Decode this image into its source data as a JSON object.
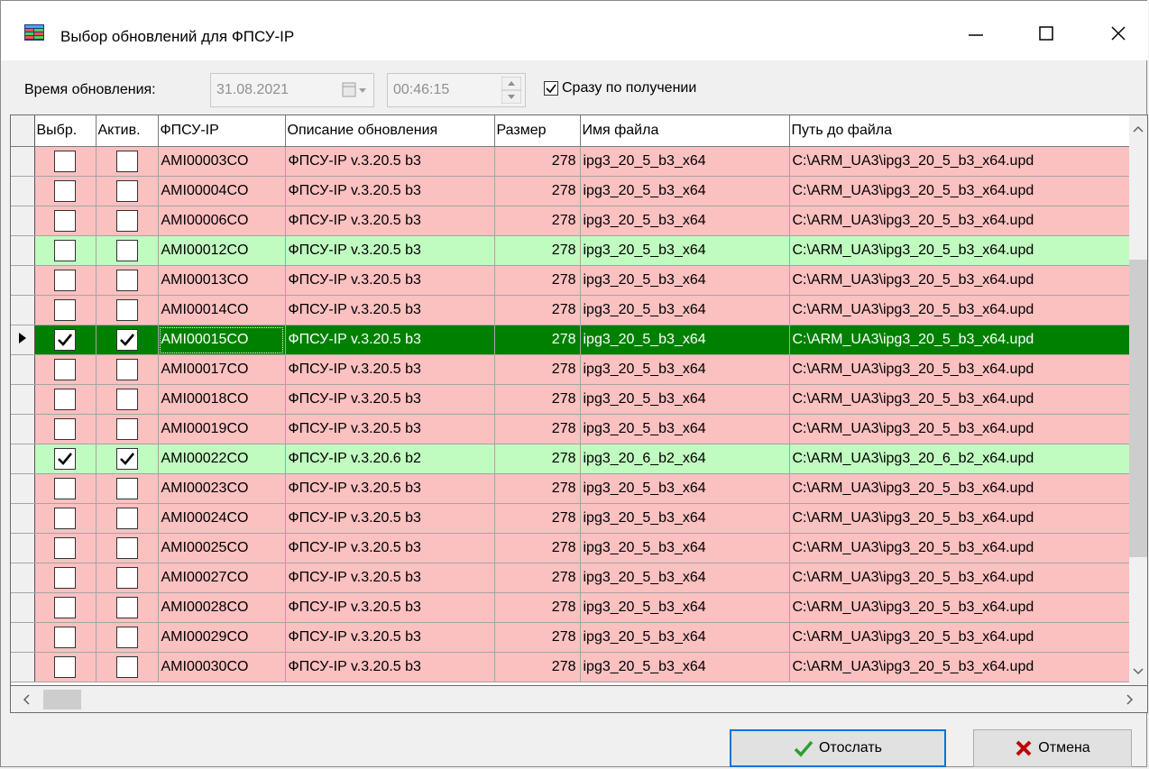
{
  "window": {
    "title": "Выбор обновлений для ФПСУ-IP"
  },
  "toolbar": {
    "time_label": "Время обновления:",
    "date_value": "31.08.2021",
    "time_value": "00:46:15",
    "immediate_label": "Сразу по получении",
    "immediate_checked": true
  },
  "table": {
    "headers": [
      "Выбр.",
      "Актив.",
      "ФПСУ-IP",
      "Описание обновления",
      "Размер",
      "Имя файла",
      "Путь до файла"
    ],
    "rows": [
      {
        "sel": false,
        "act": false,
        "id": "AMI00003CO",
        "desc": "ФПСУ-IP v.3.20.5 b3",
        "size": "278",
        "file": "ipg3_20_5_b3_x64",
        "path": "C:\\ARM_UA3\\ipg3_20_5_b3_x64.upd",
        "status": "red"
      },
      {
        "sel": false,
        "act": false,
        "id": "AMI00004CO",
        "desc": "ФПСУ-IP v.3.20.5 b3",
        "size": "278",
        "file": "ipg3_20_5_b3_x64",
        "path": "C:\\ARM_UA3\\ipg3_20_5_b3_x64.upd",
        "status": "red"
      },
      {
        "sel": false,
        "act": false,
        "id": "AMI00006CO",
        "desc": "ФПСУ-IP v.3.20.5 b3",
        "size": "278",
        "file": "ipg3_20_5_b3_x64",
        "path": "C:\\ARM_UA3\\ipg3_20_5_b3_x64.upd",
        "status": "red"
      },
      {
        "sel": false,
        "act": false,
        "id": "AMI00012CO",
        "desc": "ФПСУ-IP v.3.20.5 b3",
        "size": "278",
        "file": "ipg3_20_5_b3_x64",
        "path": "C:\\ARM_UA3\\ipg3_20_5_b3_x64.upd",
        "status": "green"
      },
      {
        "sel": false,
        "act": false,
        "id": "AMI00013CO",
        "desc": "ФПСУ-IP v.3.20.5 b3",
        "size": "278",
        "file": "ipg3_20_5_b3_x64",
        "path": "C:\\ARM_UA3\\ipg3_20_5_b3_x64.upd",
        "status": "red"
      },
      {
        "sel": false,
        "act": false,
        "id": "AMI00014CO",
        "desc": "ФПСУ-IP v.3.20.5 b3",
        "size": "278",
        "file": "ipg3_20_5_b3_x64",
        "path": "C:\\ARM_UA3\\ipg3_20_5_b3_x64.upd",
        "status": "red"
      },
      {
        "sel": true,
        "act": true,
        "id": "AMI00015CO",
        "desc": "ФПСУ-IP v.3.20.5 b3",
        "size": "278",
        "file": "ipg3_20_5_b3_x64",
        "path": "C:\\ARM_UA3\\ipg3_20_5_b3_x64.upd",
        "status": "selected"
      },
      {
        "sel": false,
        "act": false,
        "id": "AMI00017CO",
        "desc": "ФПСУ-IP v.3.20.5 b3",
        "size": "278",
        "file": "ipg3_20_5_b3_x64",
        "path": "C:\\ARM_UA3\\ipg3_20_5_b3_x64.upd",
        "status": "red"
      },
      {
        "sel": false,
        "act": false,
        "id": "AMI00018CO",
        "desc": "ФПСУ-IP v.3.20.5 b3",
        "size": "278",
        "file": "ipg3_20_5_b3_x64",
        "path": "C:\\ARM_UA3\\ipg3_20_5_b3_x64.upd",
        "status": "red"
      },
      {
        "sel": false,
        "act": false,
        "id": "AMI00019CO",
        "desc": "ФПСУ-IP v.3.20.5 b3",
        "size": "278",
        "file": "ipg3_20_5_b3_x64",
        "path": "C:\\ARM_UA3\\ipg3_20_5_b3_x64.upd",
        "status": "red"
      },
      {
        "sel": true,
        "act": true,
        "id": "AMI00022CO",
        "desc": "ФПСУ-IP v.3.20.6 b2",
        "size": "278",
        "file": "ipg3_20_6_b2_x64",
        "path": "C:\\ARM_UA3\\ipg3_20_6_b2_x64.upd",
        "status": "green"
      },
      {
        "sel": false,
        "act": false,
        "id": "AMI00023CO",
        "desc": "ФПСУ-IP v.3.20.5 b3",
        "size": "278",
        "file": "ipg3_20_5_b3_x64",
        "path": "C:\\ARM_UA3\\ipg3_20_5_b3_x64.upd",
        "status": "red"
      },
      {
        "sel": false,
        "act": false,
        "id": "AMI00024CO",
        "desc": "ФПСУ-IP v.3.20.5 b3",
        "size": "278",
        "file": "ipg3_20_5_b3_x64",
        "path": "C:\\ARM_UA3\\ipg3_20_5_b3_x64.upd",
        "status": "red"
      },
      {
        "sel": false,
        "act": false,
        "id": "AMI00025CO",
        "desc": "ФПСУ-IP v.3.20.5 b3",
        "size": "278",
        "file": "ipg3_20_5_b3_x64",
        "path": "C:\\ARM_UA3\\ipg3_20_5_b3_x64.upd",
        "status": "red"
      },
      {
        "sel": false,
        "act": false,
        "id": "AMI00027CO",
        "desc": "ФПСУ-IP v.3.20.5 b3",
        "size": "278",
        "file": "ipg3_20_5_b3_x64",
        "path": "C:\\ARM_UA3\\ipg3_20_5_b3_x64.upd",
        "status": "red"
      },
      {
        "sel": false,
        "act": false,
        "id": "AMI00028CO",
        "desc": "ФПСУ-IP v.3.20.5 b3",
        "size": "278",
        "file": "ipg3_20_5_b3_x64",
        "path": "C:\\ARM_UA3\\ipg3_20_5_b3_x64.upd",
        "status": "red"
      },
      {
        "sel": false,
        "act": false,
        "id": "AMI00029CO",
        "desc": "ФПСУ-IP v.3.20.5 b3",
        "size": "278",
        "file": "ipg3_20_5_b3_x64",
        "path": "C:\\ARM_UA3\\ipg3_20_5_b3_x64.upd",
        "status": "red"
      },
      {
        "sel": false,
        "act": false,
        "id": "AMI00030CO",
        "desc": "ФПСУ-IP v.3.20.5 b3",
        "size": "278",
        "file": "ipg3_20_5_b3_x64",
        "path": "C:\\ARM_UA3\\ipg3_20_5_b3_x64.upd",
        "status": "red"
      }
    ]
  },
  "buttons": {
    "send": "Отослать",
    "cancel": "Отмена"
  },
  "colors": {
    "row_error": "#fbc0c0",
    "row_ok": "#c0fbc0",
    "row_selected": "#008000",
    "check_green": "#2e9e2e",
    "cross_red": "#c00000"
  },
  "icons": {
    "app": "table-grid-icon",
    "minimize": "minimize-icon",
    "maximize": "maximize-icon",
    "close": "close-icon",
    "calendar": "calendar-icon",
    "send": "checkmark-icon",
    "cancel": "cross-icon"
  }
}
